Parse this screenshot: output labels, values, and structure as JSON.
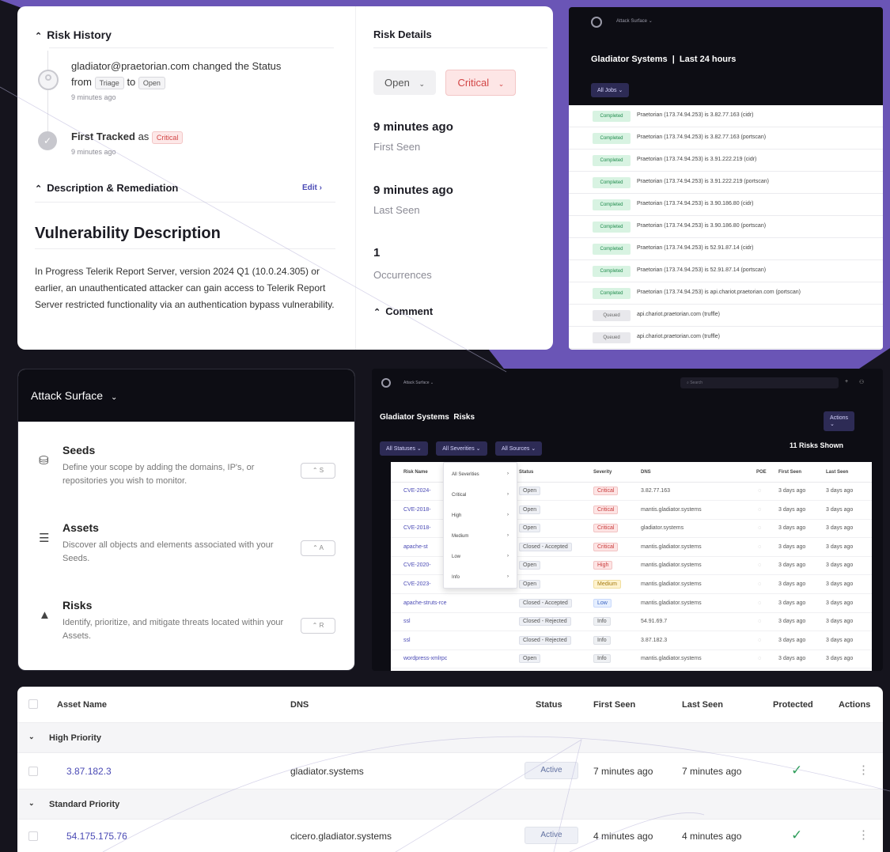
{
  "risk_card": {
    "history_title": "Risk History",
    "event1_text": "gladiator@praetorian.com changed the Status",
    "event1_from": "from",
    "event1_from_val": "Triage",
    "event1_to": "to",
    "event1_to_val": "Open",
    "event1_time": "9 minutes ago",
    "event2_text": "First Tracked",
    "event2_as": "as",
    "event2_val": "Critical",
    "event2_time": "9 minutes ago",
    "desc_title": "Description & Remediation",
    "edit_label": "Edit",
    "vuln_title": "Vulnerability Description",
    "vuln_body": "In Progress Telerik Report Server, version 2024 Q1 (10.0.24.305) or earlier, an unauthenticated attacker can gain access to Telerik Report Server restricted functionality via an authentication bypass vulnerability.",
    "details_title": "Risk Details",
    "status_value": "Open",
    "severity_value": "Critical",
    "first_seen_value": "9 minutes ago",
    "first_seen_label": "First Seen",
    "last_seen_value": "9 minutes ago",
    "last_seen_label": "Last Seen",
    "occurrences_value": "1",
    "occurrences_label": "Occurrences",
    "comment_title": "Comment"
  },
  "jobs_panel": {
    "nav_label": "Attack Surface",
    "org": "Gladiator Systems",
    "range": "Last 24 hours",
    "filter": "All Jobs",
    "rows": [
      {
        "status": "Completed",
        "text": "Praetorian (173.74.94.253) is 3.82.77.163 (cidr)",
        "kind": "done"
      },
      {
        "status": "Completed",
        "text": "Praetorian (173.74.94.253) is 3.82.77.163 (portscan)",
        "kind": "done"
      },
      {
        "status": "Completed",
        "text": "Praetorian (173.74.94.253) is 3.91.222.219 (cidr)",
        "kind": "done"
      },
      {
        "status": "Completed",
        "text": "Praetorian (173.74.94.253) is 3.91.222.219 (portscan)",
        "kind": "done"
      },
      {
        "status": "Completed",
        "text": "Praetorian (173.74.94.253) is 3.90.186.80 (cidr)",
        "kind": "done"
      },
      {
        "status": "Completed",
        "text": "Praetorian (173.74.94.253) is 3.90.186.80 (portscan)",
        "kind": "done"
      },
      {
        "status": "Completed",
        "text": "Praetorian (173.74.94.253) is 52.91.87.14 (cidr)",
        "kind": "done"
      },
      {
        "status": "Completed",
        "text": "Praetorian (173.74.94.253) is 52.91.87.14 (portscan)",
        "kind": "done"
      },
      {
        "status": "Completed",
        "text": "Praetorian (173.74.94.253) is api.chariot.praetorian.com (portscan)",
        "kind": "done"
      },
      {
        "status": "Queued",
        "text": "api.chariot.praetorian.com (truffle)",
        "kind": "queued"
      },
      {
        "status": "Queued",
        "text": "api.chariot.praetorian.com (truffle)",
        "kind": "queued"
      }
    ]
  },
  "attack_surface": {
    "title": "Attack Surface",
    "items": [
      {
        "title": "Seeds",
        "desc": "Define your scope by adding the domains, IP's, or repositories you wish to monitor.",
        "shortcut": "⌃ S"
      },
      {
        "title": "Assets",
        "desc": "Discover all objects and elements associated with your Seeds.",
        "shortcut": "⌃ A"
      },
      {
        "title": "Risks",
        "desc": "Identify, prioritize, and mitigate threats located within your Assets.",
        "shortcut": "⌃ R"
      }
    ]
  },
  "risks_panel": {
    "nav_label": "Attack Surface",
    "search_placeholder": "Search",
    "org": "Gladiator Systems",
    "page": "Risks",
    "actions": "Actions",
    "filter1": "All Statuses",
    "filter2": "All Severities",
    "filter3": "All Sources",
    "count": "11 Risks Shown",
    "headers": [
      "Risk Name",
      "Status",
      "Severity",
      "DNS",
      "POE",
      "First Seen",
      "Last Seen"
    ],
    "severity_menu": [
      "All Severities",
      "Critical",
      "High",
      "Medium",
      "Low",
      "Info"
    ],
    "rows": [
      {
        "name": "CVE-2024-",
        "status": "Open",
        "sev": "Critical",
        "sevc": "crit",
        "dns": "3.82.77.163",
        "first": "3 days ago",
        "last": "3 days ago"
      },
      {
        "name": "CVE-2018-",
        "status": "Open",
        "sev": "Critical",
        "sevc": "crit",
        "dns": "mantis.gladiator.systems",
        "first": "3 days ago",
        "last": "3 days ago"
      },
      {
        "name": "CVE-2018-",
        "status": "Open",
        "sev": "Critical",
        "sevc": "crit",
        "dns": "gladiator.systems",
        "first": "3 days ago",
        "last": "3 days ago"
      },
      {
        "name": "apache-st",
        "status": "Closed - Accepted",
        "sev": "Critical",
        "sevc": "crit",
        "dns": "mantis.gladiator.systems",
        "first": "3 days ago",
        "last": "3 days ago"
      },
      {
        "name": "CVE-2020-",
        "status": "Open",
        "sev": "High",
        "sevc": "high",
        "dns": "mantis.gladiator.systems",
        "first": "3 days ago",
        "last": "3 days ago"
      },
      {
        "name": "CVE-2023-",
        "status": "Open",
        "sev": "Medium",
        "sevc": "med",
        "dns": "mantis.gladiator.systems",
        "first": "3 days ago",
        "last": "3 days ago"
      },
      {
        "name": "apache-struts-rce",
        "status": "Closed - Accepted",
        "sev": "Low",
        "sevc": "low",
        "dns": "mantis.gladiator.systems",
        "first": "3 days ago",
        "last": "3 days ago"
      },
      {
        "name": "ssl",
        "status": "Closed - Rejected",
        "sev": "Info",
        "sevc": "info",
        "dns": "54.91.69.7",
        "first": "3 days ago",
        "last": "3 days ago"
      },
      {
        "name": "ssl",
        "status": "Closed - Rejected",
        "sev": "Info",
        "sevc": "info",
        "dns": "3.87.182.3",
        "first": "3 days ago",
        "last": "3 days ago"
      },
      {
        "name": "wordpress-xmlrpc",
        "status": "Open",
        "sev": "Info",
        "sevc": "info",
        "dns": "mantis.gladiator.systems",
        "first": "3 days ago",
        "last": "3 days ago"
      }
    ]
  },
  "assets_table": {
    "headers": {
      "name": "Asset Name",
      "dns": "DNS",
      "status": "Status",
      "first": "First Seen",
      "last": "Last Seen",
      "protected": "Protected",
      "actions": "Actions"
    },
    "group1": "High Priority",
    "row1": {
      "name": "3.87.182.3",
      "dns": "gladiator.systems",
      "status": "Active",
      "first": "7 minutes ago",
      "last": "7 minutes ago"
    },
    "group2": "Standard Priority",
    "row2": {
      "name": "54.175.175.76",
      "dns": "cicero.gladiator.systems",
      "status": "Active",
      "first": "4 minutes ago",
      "last": "4 minutes ago"
    },
    "check_glyph": "✓",
    "kebab_glyph": "⋮"
  },
  "colors": {
    "purple": "#6a55b6",
    "dark": "#0d0d14",
    "link": "#4a4ab5",
    "critical": "#d24545",
    "green": "#2f9e5b"
  }
}
